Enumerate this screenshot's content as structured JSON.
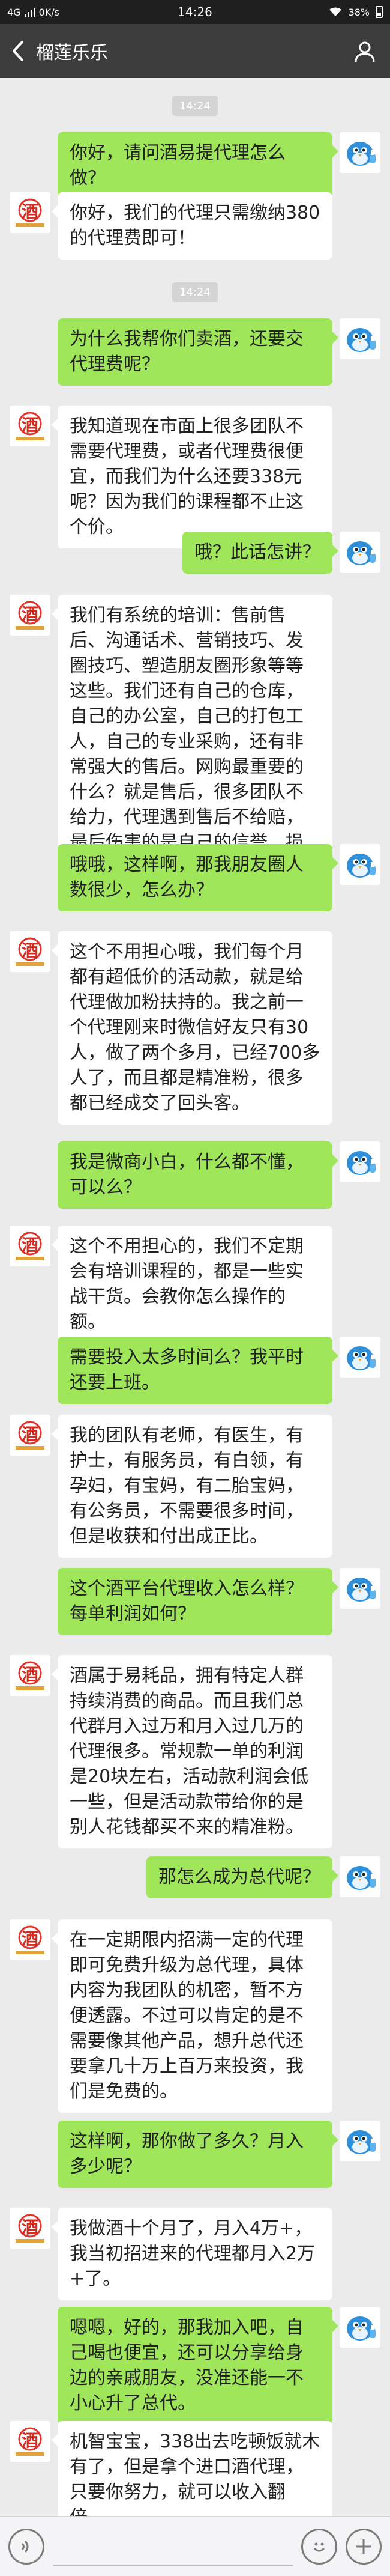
{
  "status_bar": {
    "network": "4G",
    "speed": "0K/s",
    "time": "14:26",
    "battery": "38%"
  },
  "nav": {
    "title": "榴莲乐乐"
  },
  "colors": {
    "accent_bubble": "#a0e65a",
    "left_bubble": "#ffffff",
    "background": "#ebebeb"
  },
  "messages": [
    {
      "type": "time",
      "text": "14:24"
    },
    {
      "type": "msg",
      "side": "right",
      "text": "你好，请问酒易提代理怎么做？"
    },
    {
      "type": "msg",
      "side": "left",
      "text": "你好，我们的代理只需缴纳380的代理费即可！"
    },
    {
      "type": "time",
      "text": "14:24"
    },
    {
      "type": "msg",
      "side": "right",
      "text": "为什么我帮你们卖酒，还要交代理费呢？"
    },
    {
      "type": "msg",
      "side": "left",
      "text": "我知道现在市面上很多团队不需要代理费，或者代理费很便宜，而我们为什么还要338元呢？因为我们的课程都不止这个价。"
    },
    {
      "type": "msg",
      "side": "right",
      "text": "哦？此话怎讲？"
    },
    {
      "type": "msg",
      "side": "left",
      "text": "我们有系统的培训：售前售后、沟通话术、营销技巧、发圈技巧、塑造朋友圈形象等等这些。我们还有自己的仓库，自己的办公室，自己的打包工人，自己的专业采购，还有非常强大的售后。网购最重要的什么？就是售后，很多团队不给力，代理遇到售后不给赔，最后伤害的是自己的信誉，损失的是自己。"
    },
    {
      "type": "msg",
      "side": "right",
      "text": "哦哦，这样啊，那我朋友圈人数很少，怎么办？"
    },
    {
      "type": "msg",
      "side": "left",
      "text": "这个不用担心哦，我们每个月都有超低价的活动款，就是给代理做加粉扶持的。我之前一个代理刚来时微信好友只有30人，做了两个多月，已经700多人了，而且都是精准粉，很多都已经成交了回头客。"
    },
    {
      "type": "msg",
      "side": "right",
      "text": "我是微商小白，什么都不懂，可以么？"
    },
    {
      "type": "msg",
      "side": "left",
      "text": "这个不用担心的，我们不定期会有培训课程的，都是一些实战干货。会教你怎么操作的额。"
    },
    {
      "type": "msg",
      "side": "right",
      "text": "需要投入太多时间么？我平时还要上班。"
    },
    {
      "type": "msg",
      "side": "left",
      "text": "我的团队有老师，有医生，有护士，有服务员，有白领，有孕妇，有宝妈，有二胎宝妈，有公务员，不需要很多时间，但是收获和付出成正比。"
    },
    {
      "type": "msg",
      "side": "right",
      "text": "这个酒平台代理收入怎么样？每单利润如何？"
    },
    {
      "type": "msg",
      "side": "left",
      "text": "酒属于易耗品，拥有特定人群持续消费的商品。而且我们总代群月入过万和月入过几万的代理很多。常规款一单的利润是20块左右，活动款利润会低一些，但是活动款带给你的是别人花钱都买不来的精准粉。"
    },
    {
      "type": "msg",
      "side": "right",
      "text": "那怎么成为总代呢？"
    },
    {
      "type": "msg",
      "side": "left",
      "text": "在一定期限内招满一定的代理即可免费升级为总代理，具体内容为我团队的机密，暂不方便透露。不过可以肯定的是不需要像其他产品，想升总代还要拿几十万上百万来投资，我们是免费的。"
    },
    {
      "type": "msg",
      "side": "right",
      "text": "这样啊，那你做了多久？月入多少呢？"
    },
    {
      "type": "msg",
      "side": "left",
      "text": "我做酒十个月了，月入4万+，我当初招进来的代理都月入2万+了。"
    },
    {
      "type": "msg",
      "side": "right",
      "text": "嗯嗯，好的，那我加入吧，自己喝也便宜，还可以分享给身边的亲戚朋友，没准还能一不小心升了总代。"
    },
    {
      "type": "msg",
      "side": "left",
      "text": "机智宝宝，338出去吃顿饭就木有了，但是拿个进口酒代理，只要你努力，就可以收入翻倍。"
    }
  ]
}
